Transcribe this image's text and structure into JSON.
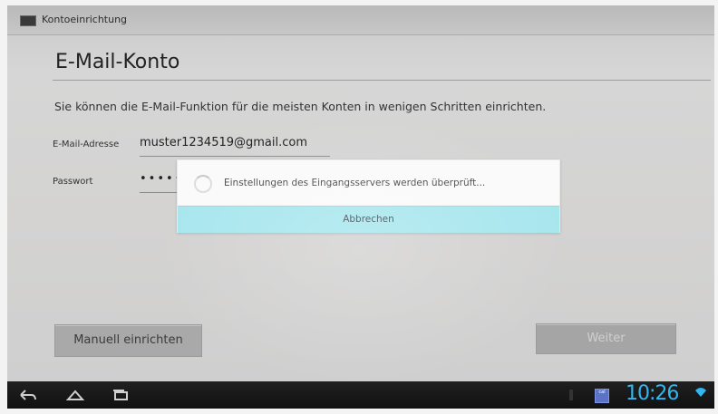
{
  "action_bar": {
    "title": "Kontoeinrichtung",
    "icon": "app-icon"
  },
  "page": {
    "title": "E-Mail-Konto",
    "intro": "Sie können die E-Mail-Funktion für die meisten Konten in wenigen Schritten einrichten."
  },
  "form": {
    "email_label": "E-Mail-Adresse",
    "email_value": "muster1234519@gmail.com",
    "password_label": "Passwort",
    "password_value": "•••••"
  },
  "buttons": {
    "manual": "Manuell einrichten",
    "next": "Weiter"
  },
  "dialog": {
    "message": "Einstellungen des Eingangsservers werden überprüft...",
    "cancel": "Abbrechen",
    "spinner_icon": "loading-spinner-icon"
  },
  "system_bar": {
    "time": "10:26",
    "calendar_label": "cal",
    "icons": [
      "back-icon",
      "home-icon",
      "recent-apps-icon",
      "calendar-icon",
      "wifi-icon"
    ],
    "clock_color": "#32b6f0"
  },
  "colors": {
    "dialog_button": "#a8e6ee",
    "accent": "#32b6f0"
  }
}
